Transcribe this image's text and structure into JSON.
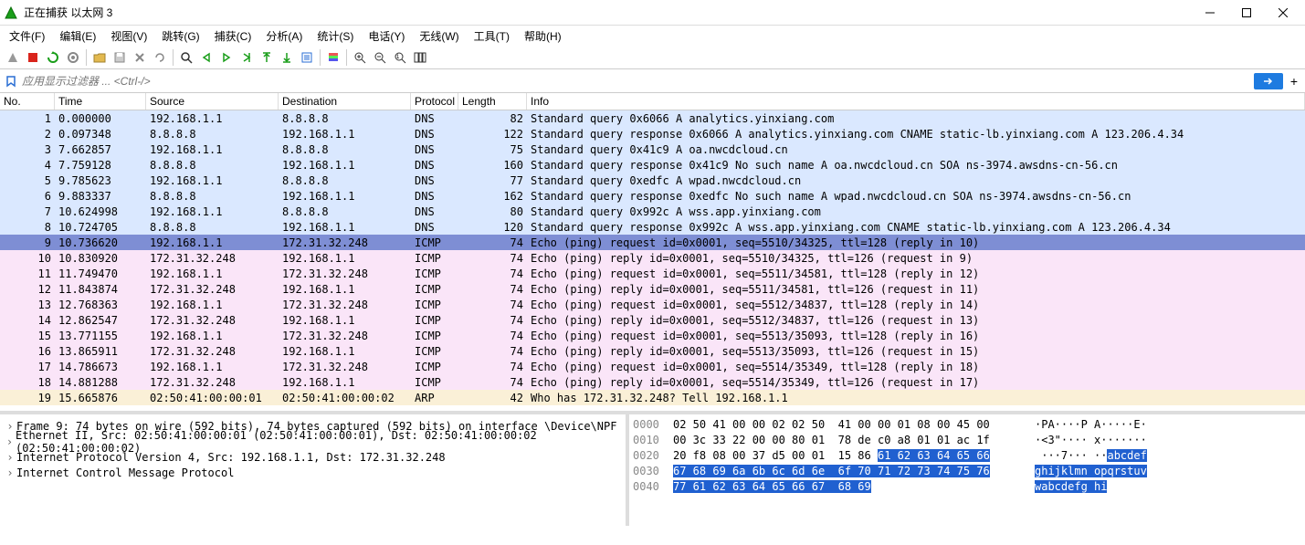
{
  "window": {
    "title": "正在捕获 以太网 3"
  },
  "menubar": [
    "文件(F)",
    "编辑(E)",
    "视图(V)",
    "跳转(G)",
    "捕获(C)",
    "分析(A)",
    "统计(S)",
    "电话(Y)",
    "无线(W)",
    "工具(T)",
    "帮助(H)"
  ],
  "filter": {
    "placeholder": "应用显示过滤器 ... <Ctrl-/>"
  },
  "columns": [
    "No.",
    "Time",
    "Source",
    "Destination",
    "Protocol",
    "Length",
    "Info"
  ],
  "packets": [
    {
      "no": 1,
      "time": "0.000000",
      "src": "192.168.1.1",
      "dst": "8.8.8.8",
      "proto": "DNS",
      "len": 82,
      "info": "Standard query 0x6066 A analytics.yinxiang.com",
      "bg": "dns"
    },
    {
      "no": 2,
      "time": "0.097348",
      "src": "8.8.8.8",
      "dst": "192.168.1.1",
      "proto": "DNS",
      "len": 122,
      "info": "Standard query response 0x6066 A analytics.yinxiang.com CNAME static-lb.yinxiang.com A 123.206.4.34",
      "bg": "dns"
    },
    {
      "no": 3,
      "time": "7.662857",
      "src": "192.168.1.1",
      "dst": "8.8.8.8",
      "proto": "DNS",
      "len": 75,
      "info": "Standard query 0x41c9 A oa.nwcdcloud.cn",
      "bg": "dns"
    },
    {
      "no": 4,
      "time": "7.759128",
      "src": "8.8.8.8",
      "dst": "192.168.1.1",
      "proto": "DNS",
      "len": 160,
      "info": "Standard query response 0x41c9 No such name A oa.nwcdcloud.cn SOA ns-3974.awsdns-cn-56.cn",
      "bg": "dns"
    },
    {
      "no": 5,
      "time": "9.785623",
      "src": "192.168.1.1",
      "dst": "8.8.8.8",
      "proto": "DNS",
      "len": 77,
      "info": "Standard query 0xedfc A wpad.nwcdcloud.cn",
      "bg": "dns"
    },
    {
      "no": 6,
      "time": "9.883337",
      "src": "8.8.8.8",
      "dst": "192.168.1.1",
      "proto": "DNS",
      "len": 162,
      "info": "Standard query response 0xedfc No such name A wpad.nwcdcloud.cn SOA ns-3974.awsdns-cn-56.cn",
      "bg": "dns"
    },
    {
      "no": 7,
      "time": "10.624998",
      "src": "192.168.1.1",
      "dst": "8.8.8.8",
      "proto": "DNS",
      "len": 80,
      "info": "Standard query 0x992c A wss.app.yinxiang.com",
      "bg": "dns"
    },
    {
      "no": 8,
      "time": "10.724705",
      "src": "8.8.8.8",
      "dst": "192.168.1.1",
      "proto": "DNS",
      "len": 120,
      "info": "Standard query response 0x992c A wss.app.yinxiang.com CNAME static-lb.yinxiang.com A 123.206.4.34",
      "bg": "dns"
    },
    {
      "no": 9,
      "time": "10.736620",
      "src": "192.168.1.1",
      "dst": "172.31.32.248",
      "proto": "ICMP",
      "len": 74,
      "info": "Echo (ping) request  id=0x0001, seq=5510/34325, ttl=128 (reply in 10)",
      "bg": "selected"
    },
    {
      "no": 10,
      "time": "10.830920",
      "src": "172.31.32.248",
      "dst": "192.168.1.1",
      "proto": "ICMP",
      "len": 74,
      "info": "Echo (ping) reply    id=0x0001, seq=5510/34325, ttl=126 (request in 9)",
      "bg": "icmp"
    },
    {
      "no": 11,
      "time": "11.749470",
      "src": "192.168.1.1",
      "dst": "172.31.32.248",
      "proto": "ICMP",
      "len": 74,
      "info": "Echo (ping) request  id=0x0001, seq=5511/34581, ttl=128 (reply in 12)",
      "bg": "icmp"
    },
    {
      "no": 12,
      "time": "11.843874",
      "src": "172.31.32.248",
      "dst": "192.168.1.1",
      "proto": "ICMP",
      "len": 74,
      "info": "Echo (ping) reply    id=0x0001, seq=5511/34581, ttl=126 (request in 11)",
      "bg": "icmp"
    },
    {
      "no": 13,
      "time": "12.768363",
      "src": "192.168.1.1",
      "dst": "172.31.32.248",
      "proto": "ICMP",
      "len": 74,
      "info": "Echo (ping) request  id=0x0001, seq=5512/34837, ttl=128 (reply in 14)",
      "bg": "icmp"
    },
    {
      "no": 14,
      "time": "12.862547",
      "src": "172.31.32.248",
      "dst": "192.168.1.1",
      "proto": "ICMP",
      "len": 74,
      "info": "Echo (ping) reply    id=0x0001, seq=5512/34837, ttl=126 (request in 13)",
      "bg": "icmp"
    },
    {
      "no": 15,
      "time": "13.771155",
      "src": "192.168.1.1",
      "dst": "172.31.32.248",
      "proto": "ICMP",
      "len": 74,
      "info": "Echo (ping) request  id=0x0001, seq=5513/35093, ttl=128 (reply in 16)",
      "bg": "icmp"
    },
    {
      "no": 16,
      "time": "13.865911",
      "src": "172.31.32.248",
      "dst": "192.168.1.1",
      "proto": "ICMP",
      "len": 74,
      "info": "Echo (ping) reply    id=0x0001, seq=5513/35093, ttl=126 (request in 15)",
      "bg": "icmp"
    },
    {
      "no": 17,
      "time": "14.786673",
      "src": "192.168.1.1",
      "dst": "172.31.32.248",
      "proto": "ICMP",
      "len": 74,
      "info": "Echo (ping) request  id=0x0001, seq=5514/35349, ttl=128 (reply in 18)",
      "bg": "icmp"
    },
    {
      "no": 18,
      "time": "14.881288",
      "src": "172.31.32.248",
      "dst": "192.168.1.1",
      "proto": "ICMP",
      "len": 74,
      "info": "Echo (ping) reply    id=0x0001, seq=5514/35349, ttl=126 (request in 17)",
      "bg": "icmp"
    },
    {
      "no": 19,
      "time": "15.665876",
      "src": "02:50:41:00:00:01",
      "dst": "02:50:41:00:00:02",
      "proto": "ARP",
      "len": 42,
      "info": "Who has 172.31.32.248? Tell 192.168.1.1",
      "bg": "arp"
    }
  ],
  "details": [
    "Frame 9: 74 bytes on wire (592 bits), 74 bytes captured (592 bits) on interface \\Device\\NPF",
    "Ethernet II, Src: 02:50:41:00:00:01 (02:50:41:00:00:01), Dst: 02:50:41:00:00:02 (02:50:41:00:00:02)",
    "Internet Protocol Version 4, Src: 192.168.1.1, Dst: 172.31.32.248",
    "Internet Control Message Protocol"
  ],
  "bytes": [
    {
      "off": "0000",
      "hex": "02 50 41 00 00 02 02 50  41 00 00 01 08 00 45 00",
      "asc": "·PA····P A·····E·",
      "hl": []
    },
    {
      "off": "0010",
      "hex": "00 3c 33 22 00 00 80 01  78 de c0 a8 01 01 ac 1f",
      "asc": "·<3\"···· x·······",
      "hl": []
    },
    {
      "off": "0020",
      "hex": "20 f8 08 00 37 d5 00 01  15 86 ",
      "asc": " ···7··· ··",
      "tail_hex": "61 62 63 64 65 66",
      "tail_asc": "abcdef"
    },
    {
      "off": "0030",
      "hex": "",
      "asc": "",
      "full_hex": "67 68 69 6a 6b 6c 6d 6e  6f 70 71 72 73 74 75 76",
      "full_asc": "ghijklmn opqrstuv"
    },
    {
      "off": "0040",
      "hex": "",
      "asc": "",
      "full_hex": "77 61 62 63 64 65 66 67  68 69",
      "full_asc": "wabcdefg hi"
    }
  ]
}
